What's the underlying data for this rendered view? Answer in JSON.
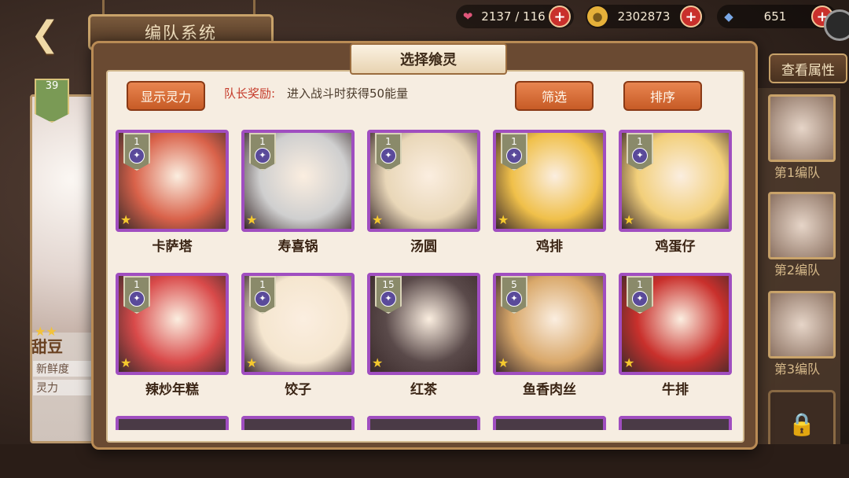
{
  "header": {
    "back_icon": "back-arrow-icon",
    "title": "编队系统",
    "view_attr": "查看属性"
  },
  "resources": [
    {
      "icon": "heart-icon",
      "value": "2137 / 116",
      "color": "#e0567a"
    },
    {
      "icon": "coin-icon",
      "value": "2302873",
      "color": "#e6b13a"
    },
    {
      "icon": "crystal-icon",
      "value": "651",
      "color": "#7aa8e6"
    }
  ],
  "hero": {
    "level": "39",
    "name": "甜豆",
    "stat1": "新鲜度",
    "stat2": "灵力"
  },
  "team": {
    "slots": [
      "第1编队",
      "第2编队",
      "第3编队"
    ]
  },
  "modal": {
    "title": "选择飨灵",
    "show_power": "显示灵力",
    "leader_label": "队长奖励:",
    "leader_text": "进入战斗时获得50能量",
    "filter": "筛选",
    "sort": "排序"
  },
  "cards": [
    {
      "name": "卡萨塔",
      "level": "1",
      "color": "#d9624a"
    },
    {
      "name": "寿喜锅",
      "level": "1",
      "color": "#cfcfcf"
    },
    {
      "name": "汤圆",
      "level": "1",
      "color": "#e9d7b8"
    },
    {
      "name": "鸡排",
      "level": "1",
      "color": "#f0c04a"
    },
    {
      "name": "鸡蛋仔",
      "level": "1",
      "color": "#f2cf7a"
    },
    {
      "name": "辣炒年糕",
      "level": "1",
      "color": "#d94a4a"
    },
    {
      "name": "饺子",
      "level": "1",
      "color": "#f5e6cf"
    },
    {
      "name": "红茶",
      "level": "15",
      "color": "#5a4a4a"
    },
    {
      "name": "鱼香肉丝",
      "level": "5",
      "color": "#d9a86a"
    },
    {
      "name": "牛排",
      "level": "1",
      "color": "#c9302c"
    }
  ]
}
